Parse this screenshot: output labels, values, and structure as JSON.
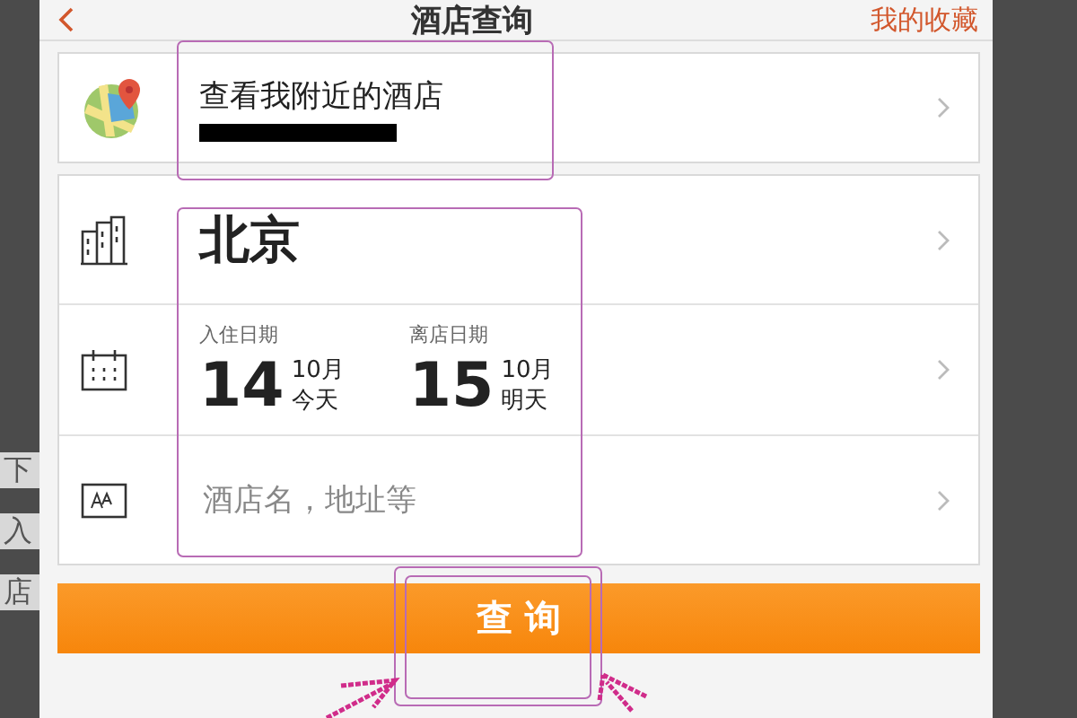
{
  "background_text": [
    "下",
    "入",
    "店"
  ],
  "header": {
    "title": "酒店查询",
    "action": "我的收藏"
  },
  "nearby": {
    "title": "查看我附近的酒店",
    "redacted": true
  },
  "search_form": {
    "city": "北京",
    "dates": [
      {
        "label": "入住日期",
        "day": "14",
        "month": "10月",
        "relative": "今天"
      },
      {
        "label": "离店日期",
        "day": "15",
        "month": "10月",
        "relative": "明天"
      }
    ],
    "keyword": {
      "placeholder": "酒店名，地址等"
    }
  },
  "search_button": "查 询"
}
